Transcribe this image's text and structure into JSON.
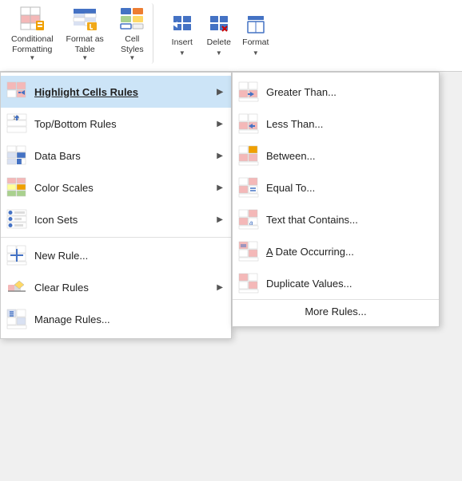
{
  "ribbon": {
    "groups": [
      {
        "id": "conditional",
        "buttons": [
          {
            "label": "Conditional\nFormatting",
            "arrow": true
          },
          {
            "label": "Format as\nTable",
            "arrow": true
          },
          {
            "label": "Cell\nStyles",
            "arrow": true
          }
        ]
      },
      {
        "id": "cells",
        "buttons": [
          {
            "label": "Insert",
            "arrow": true
          },
          {
            "label": "Delete",
            "arrow": true
          },
          {
            "label": "Format",
            "arrow": true
          }
        ]
      }
    ]
  },
  "mainMenu": {
    "items": [
      {
        "id": "highlight",
        "label": "Highlight Cells Rules",
        "hasArrow": true,
        "active": true
      },
      {
        "id": "topbottom",
        "label": "Top/Bottom Rules",
        "hasArrow": true
      },
      {
        "id": "databars",
        "label": "Data Bars",
        "hasArrow": true
      },
      {
        "id": "colorscales",
        "label": "Color Scales",
        "hasArrow": true
      },
      {
        "id": "iconsets",
        "label": "Icon Sets",
        "hasArrow": true
      },
      {
        "id": "sep1",
        "separator": true
      },
      {
        "id": "newrule",
        "label": "New Rule..."
      },
      {
        "id": "clearrules",
        "label": "Clear Rules",
        "hasArrow": true
      },
      {
        "id": "managerules",
        "label": "Manage Rules..."
      }
    ]
  },
  "subMenu": {
    "items": [
      {
        "id": "greaterthan",
        "label": "Greater Than..."
      },
      {
        "id": "lessthan",
        "label": "Less Than..."
      },
      {
        "id": "between",
        "label": "Between..."
      },
      {
        "id": "equalto",
        "label": "Equal To..."
      },
      {
        "id": "textcontains",
        "label": "Text that Contains..."
      },
      {
        "id": "dateoccurring",
        "label": "A Date Occurring...",
        "underlineChar": "A"
      },
      {
        "id": "duplicatevalues",
        "label": "Duplicate Values..."
      }
    ],
    "footer": "More Rules..."
  },
  "icons": {
    "conditional_formatting": "conditional-formatting-icon",
    "format_as_table": "format-as-table-icon",
    "cell_styles": "cell-styles-icon",
    "insert": "insert-icon",
    "delete": "delete-icon",
    "format": "format-icon"
  }
}
